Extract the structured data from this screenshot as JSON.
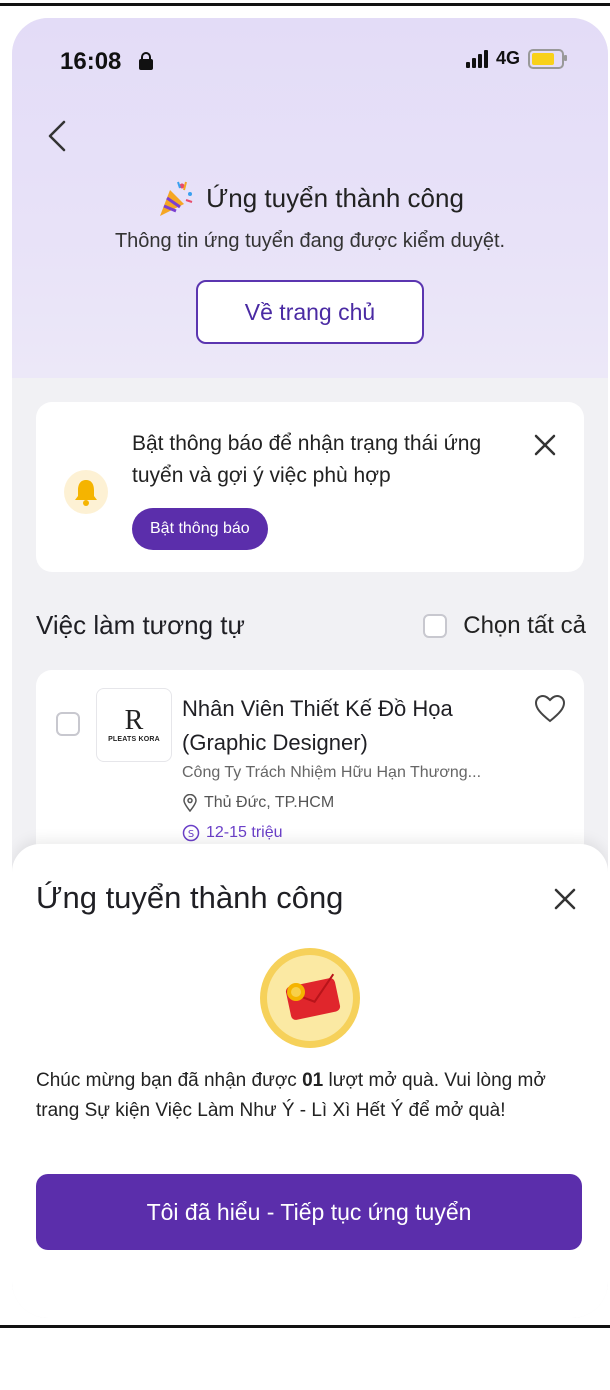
{
  "status_bar": {
    "time": "16:08",
    "network": "4G"
  },
  "header": {
    "title": "Ứng tuyển thành công",
    "subtitle": "Thông tin ứng tuyển đang được kiểm duyệt.",
    "home_button": "Về trang chủ"
  },
  "notification_card": {
    "message": "Bật thông báo để nhận trạng thái ứng tuyển và gợi ý việc phù hợp",
    "button": "Bật thông báo"
  },
  "similar_jobs": {
    "title": "Việc làm tương tự",
    "select_all": "Chọn tất cả",
    "jobs": [
      {
        "logo_mark": "R",
        "logo_text": "PLEATS KORA",
        "title": "Nhân Viên Thiết Kế Đồ Họa (Graphic Designer)",
        "company": "Công Ty Trách Nhiệm Hữu Hạn Thương...",
        "location": "Thủ Đức, TP.HCM",
        "salary": "12-15 triệu"
      }
    ]
  },
  "success_sheet": {
    "title": "Ứng tuyển thành công",
    "message_before": "Chúc mừng bạn đã nhận được ",
    "message_bold": "01",
    "message_after": " lượt mở quà. Vui lòng mở trang Sự kiện Việc Làm Như Ý - Lì Xì Hết Ý để mở quà!",
    "primary_button": "Tôi đã hiểu - Tiếp tục ứng tuyển"
  },
  "colors": {
    "accent": "#5b2eab",
    "hero_bg": "#e3dcf7",
    "battery": "#f8d11a",
    "salary": "#6a3fc8"
  }
}
